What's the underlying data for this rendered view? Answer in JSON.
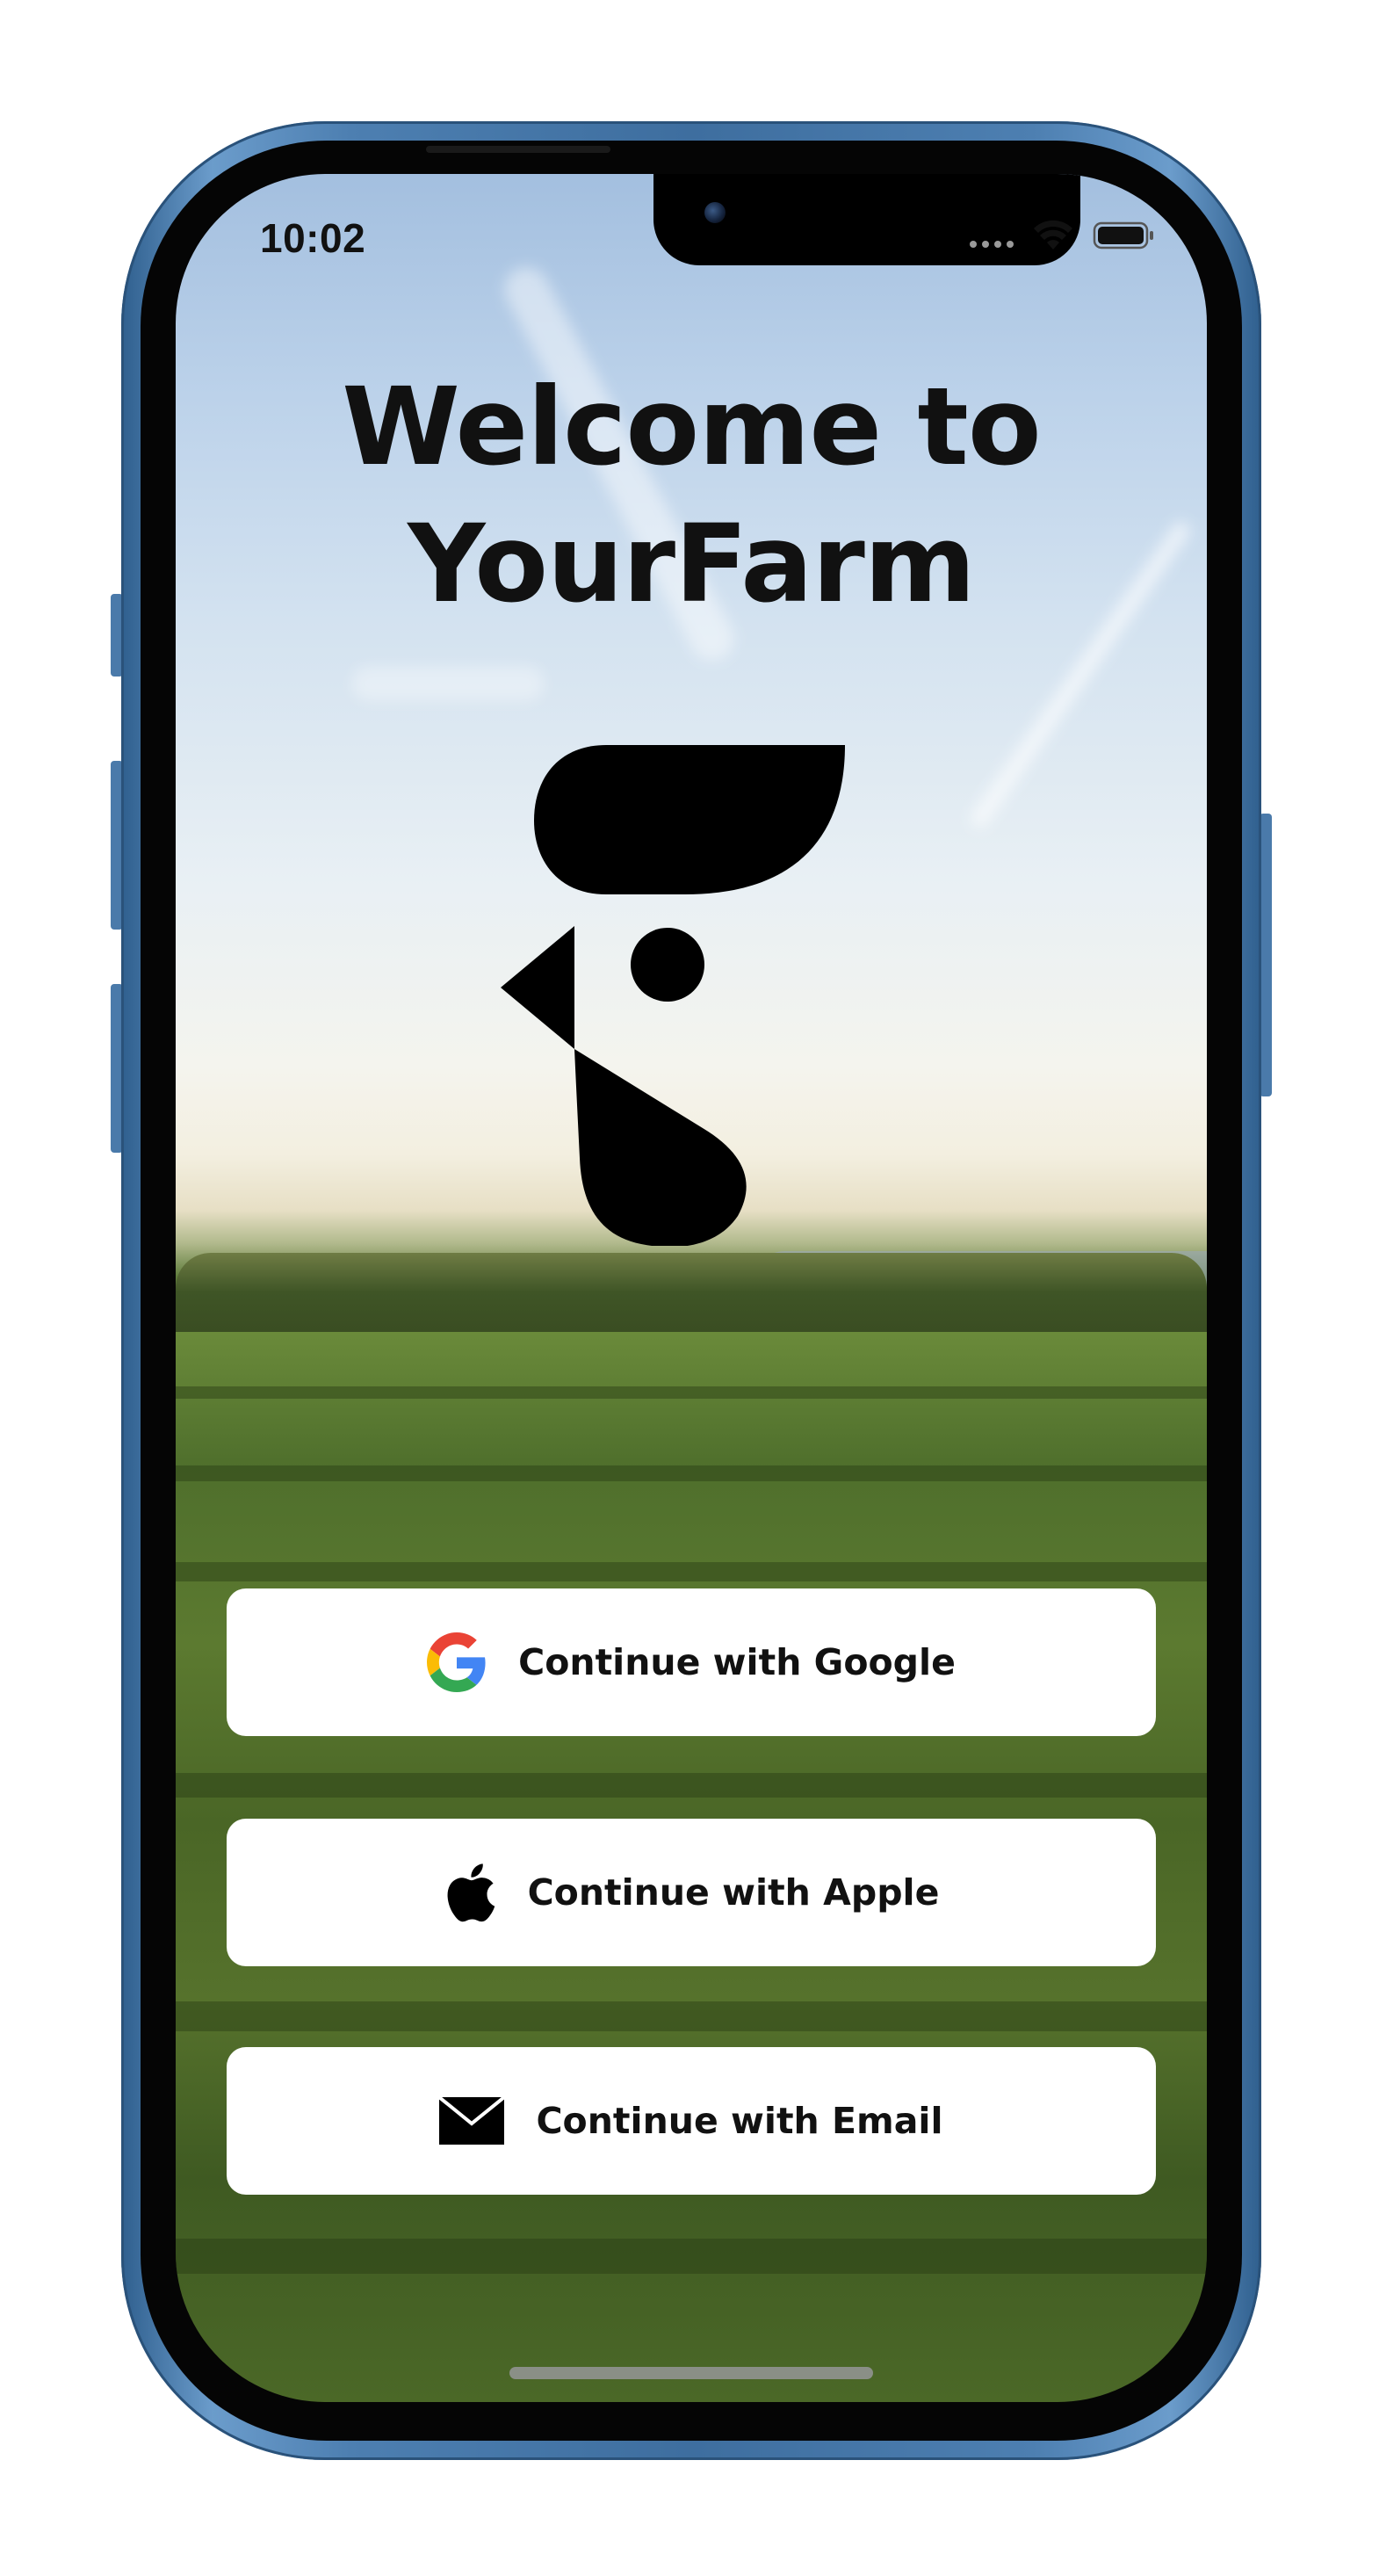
{
  "status_bar": {
    "time": "10:02",
    "icons": [
      "cellular-dots-icon",
      "wifi-icon",
      "battery-icon"
    ]
  },
  "welcome": {
    "title_line1": "Welcome to",
    "title_line2": "YourFarm"
  },
  "logo": {
    "icon": "yourfarm-rooster-logo",
    "color": "#000000"
  },
  "auth": {
    "google": {
      "label": "Continue with Google",
      "icon": "google-g-icon"
    },
    "apple": {
      "label": "Continue with Apple",
      "icon": "apple-icon"
    },
    "email": {
      "label": "Continue with Email",
      "icon": "envelope-icon"
    }
  },
  "colors": {
    "device_frame": "#4a7aaa",
    "button_background": "#ffffff",
    "text": "#111111",
    "google_blue": "#4285F4",
    "google_red": "#EA4335",
    "google_yellow": "#FBBC05",
    "google_green": "#34A853"
  }
}
